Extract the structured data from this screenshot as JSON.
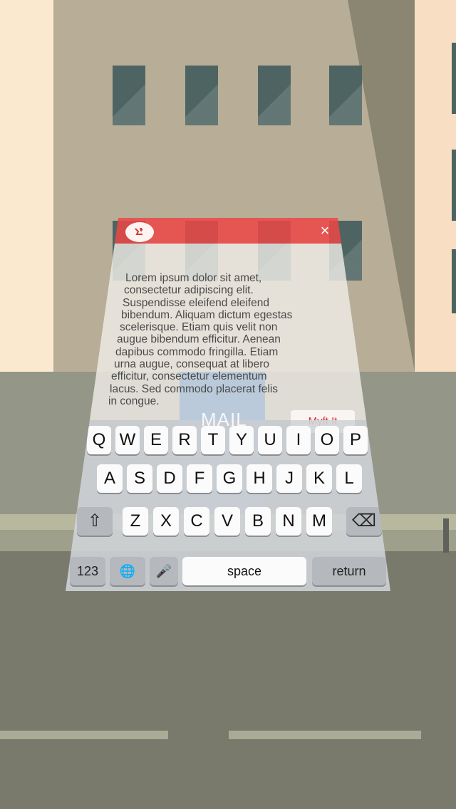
{
  "notification": {
    "lines": [
      "Lorem ipsum dolor sit amet,",
      "consectetur adipiscing elit.",
      "Suspendisse eleifend eleifend",
      "bibendum. Aliquam dictum egestas",
      "scelerisque. Etiam quis velit non",
      "augue bibendum efficitur. Aenean",
      "dapibus commodo fringilla. Etiam",
      "urna augue, consequat at libero",
      "efficitur, consectetur elementum",
      "lacus. Sed commodo placerat felis",
      "in congue."
    ],
    "action_label": "Myft It",
    "close_glyph": "×",
    "background_label": "MAIL"
  },
  "keyboard": {
    "row1": [
      "Q",
      "W",
      "E",
      "R",
      "T",
      "Y",
      "U",
      "I",
      "O",
      "P"
    ],
    "row2": [
      "A",
      "S",
      "D",
      "F",
      "G",
      "H",
      "J",
      "K",
      "L"
    ],
    "row3": [
      "Z",
      "X",
      "C",
      "V",
      "B",
      "N",
      "M"
    ],
    "shift_glyph": "⇧",
    "delete_glyph": "⌫",
    "numbers_label": "123",
    "globe_glyph": "🌐",
    "mic_glyph": "🎤",
    "space_label": "space",
    "return_label": "return"
  },
  "colors": {
    "header_red": "#ec4646",
    "action_red": "#d33a3a"
  }
}
